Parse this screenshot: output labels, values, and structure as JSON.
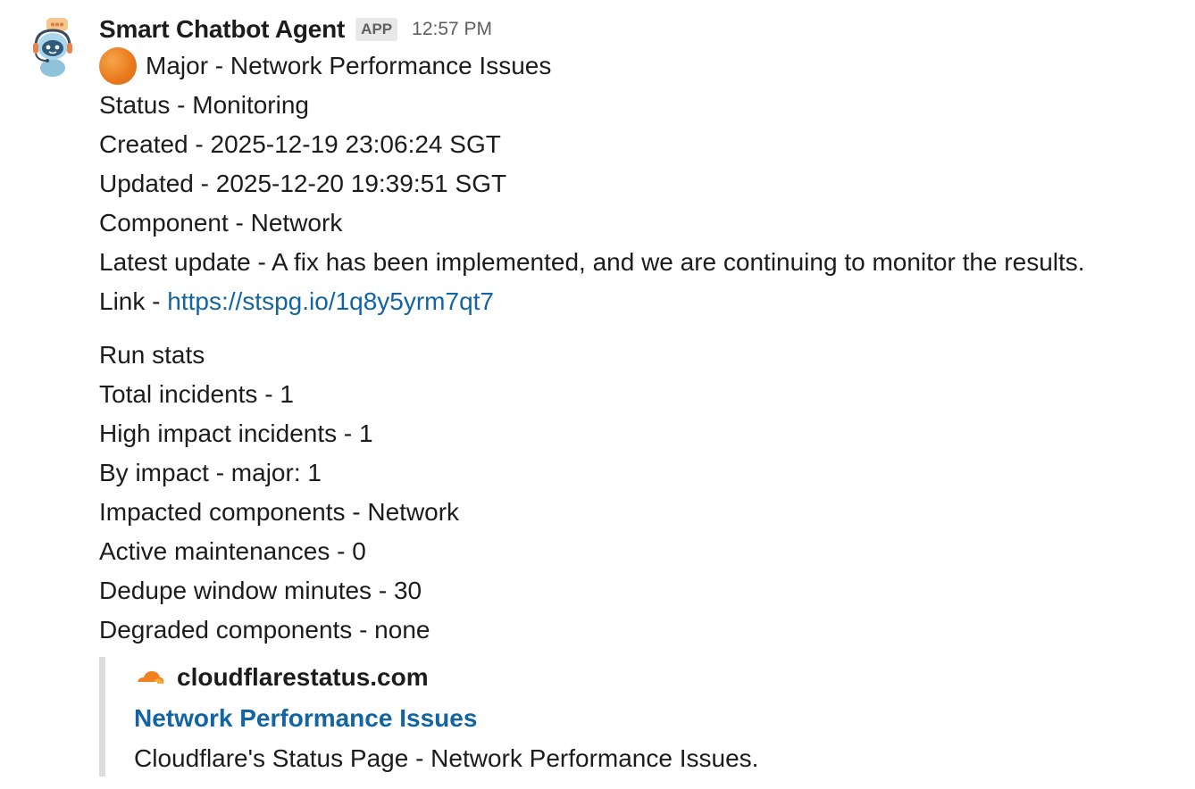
{
  "message": {
    "sender": "Smart Chatbot Agent",
    "badge": "APP",
    "time": "12:57 PM",
    "avatar_icon": "robot-headset-icon",
    "title_icon": "orange-circle-icon",
    "title": "Major - Network Performance Issues",
    "status": "Status - Monitoring",
    "created": "Created - 2025-12-19 23:06:24 SGT",
    "updated": "Updated - 2025-12-20 19:39:51 SGT",
    "component": "Component - Network",
    "latest_update": "Latest update - A fix has been implemented, and we are continuing to monitor the results.",
    "link_label": "Link - ",
    "link_url": "https://stspg.io/1q8y5yrm7qt7"
  },
  "run_stats": {
    "heading": "Run stats",
    "total_incidents": "Total incidents - 1",
    "high_impact": "High impact incidents - 1",
    "by_impact": "By impact - major: 1",
    "impacted_components": "Impacted components - Network",
    "active_maintenances": "Active maintenances - 0",
    "dedupe_window": "Dedupe window minutes - 30",
    "degraded_components": "Degraded components - none"
  },
  "attachment": {
    "source_icon": "cloudflare-icon",
    "source_name": "cloudflarestatus.com",
    "title": "Network Performance Issues",
    "description": "Cloudflare's Status Page - Network Performance Issues."
  },
  "colors": {
    "link": "#1264a3",
    "text": "#1d1c1d",
    "muted": "#616061",
    "accent_orange": "#ea7c1f",
    "attachment_border": "#dddddd"
  }
}
